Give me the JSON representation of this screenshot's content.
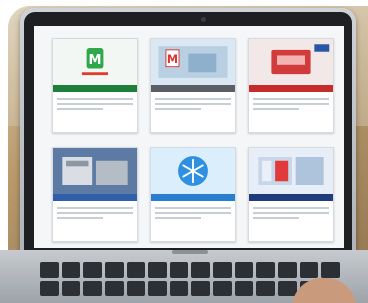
{
  "scene": "photo",
  "laptop_screen": {
    "tiles": [
      {
        "icon": "m-logo-icon",
        "accent": "#1e7f3b",
        "thumb_bg": "#f2f7f3"
      },
      {
        "icon": "m-logo-icon",
        "accent": "#5a5f66",
        "thumb_bg": "#d9e8f3"
      },
      {
        "icon": "red-product-icon",
        "accent": "#c72c2c",
        "thumb_bg": "#f3e8e8"
      },
      {
        "icon": "machine-icon",
        "accent": "#2f5fa8",
        "thumb_bg": "#5c7aa3"
      },
      {
        "icon": "snowflake-icon",
        "accent": "#2a7ed0",
        "thumb_bg": "#dbeefb"
      },
      {
        "icon": "cold-room-icon",
        "accent": "#1f3d7a",
        "thumb_bg": "#e7eef7"
      }
    ]
  }
}
